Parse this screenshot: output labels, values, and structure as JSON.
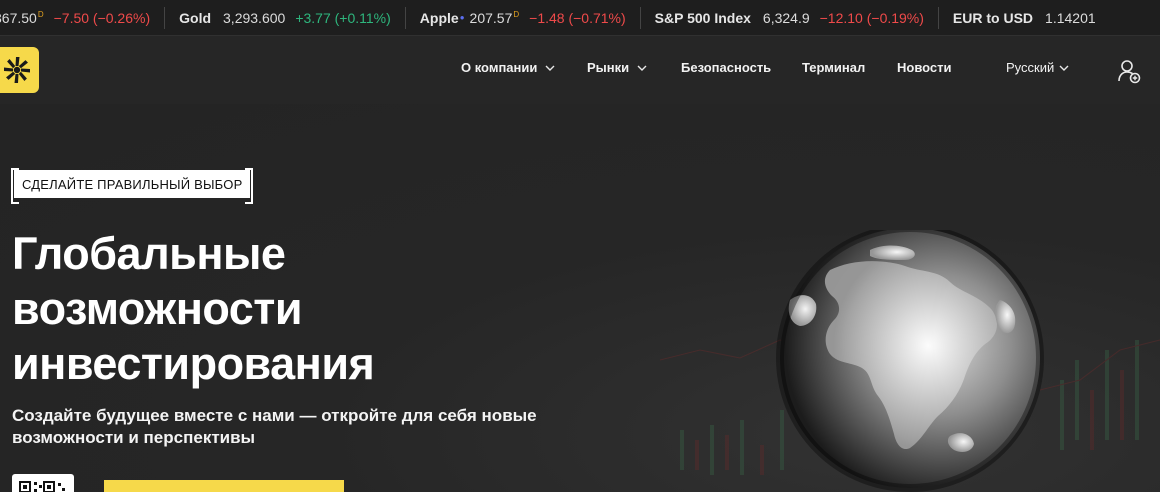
{
  "ticker": [
    {
      "name": "",
      "price": "367.50",
      "marker": "D",
      "change": "−7.50 (−0.26%)",
      "direction": "down"
    },
    {
      "name": "Gold",
      "price": "3,293.600",
      "marker": "",
      "change": "+3.77 (+0.11%)",
      "direction": "up"
    },
    {
      "name": "Apple",
      "price": "207.57",
      "marker": "D",
      "change": "−1.48 (−0.71%)",
      "direction": "down"
    },
    {
      "name": "S&P 500 Index",
      "price": "6,324.9",
      "marker": "",
      "change": "−12.10 (−0.19%)",
      "direction": "down"
    },
    {
      "name": "EUR to USD",
      "price": "1.14201",
      "marker": "",
      "change": "",
      "direction": "none"
    }
  ],
  "nav": {
    "about": "О компании",
    "markets": "Рынки",
    "security": "Безопасность",
    "terminal": "Терминал",
    "news": "Новости",
    "language": "Русский"
  },
  "hero": {
    "badge": "СДЕЛАЙТЕ ПРАВИЛЬНЫЙ ВЫБОР",
    "title_line1": "Глобальные",
    "title_line2": "возможности",
    "title_line3": "инвестирования",
    "subtitle_line1": "Создайте будущее вместе с нами — откройте для себя новые",
    "subtitle_line2": "возможности и перспективы"
  },
  "colors": {
    "background": "#262626",
    "accent": "#f6d94a",
    "negative": "#ef4a4a",
    "positive": "#2eb67d"
  },
  "icons": {
    "logo": "brand-logo",
    "dropdown": "chevron-down-icon",
    "account": "user-add-icon",
    "qr": "qr-code-icon"
  }
}
